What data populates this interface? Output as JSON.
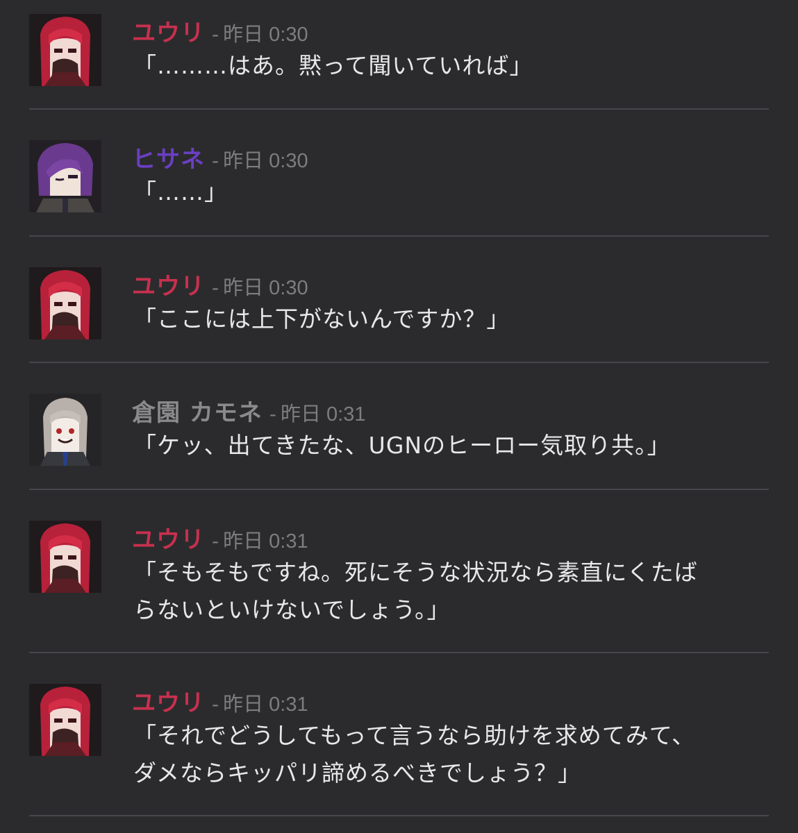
{
  "colors": {
    "background": "#2b2b2d",
    "divider": "#47474b",
    "text": "#e8e8ea",
    "meta": "#7d7d80"
  },
  "messages": [
    {
      "speaker": "ユウリ",
      "speaker_color": "#c8304f",
      "avatar": "yuuri-avatar",
      "separator": "-",
      "time": "昨日 0:30",
      "text": "「………はあ。黙って聞いていれば」"
    },
    {
      "speaker": "ヒサネ",
      "speaker_color": "#6a3fc2",
      "avatar": "hisane-avatar",
      "separator": "-",
      "time": "昨日 0:30",
      "text": "「……」"
    },
    {
      "speaker": "ユウリ",
      "speaker_color": "#c8304f",
      "avatar": "yuuri-avatar",
      "separator": "-",
      "time": "昨日 0:30",
      "text": "「ここには上下がないんですか？」"
    },
    {
      "speaker": "倉園 カモネ",
      "speaker_color": "#8a8a8d",
      "avatar": "kamone-avatar",
      "separator": "-",
      "time": "昨日 0:31",
      "text": "「ケッ、出てきたな、UGNのヒーロー気取り共。」"
    },
    {
      "speaker": "ユウリ",
      "speaker_color": "#c8304f",
      "avatar": "yuuri-avatar",
      "separator": "-",
      "time": "昨日 0:31",
      "text": "「そもそもですね。死にそうな状況なら素直にくたば\nらないといけないでしょう。」"
    },
    {
      "speaker": "ユウリ",
      "speaker_color": "#c8304f",
      "avatar": "yuuri-avatar",
      "separator": "-",
      "time": "昨日 0:31",
      "text": "「それでどうしてもって言うなら助けを求めてみて、\nダメならキッパリ諦めるべきでしょう？」"
    }
  ]
}
